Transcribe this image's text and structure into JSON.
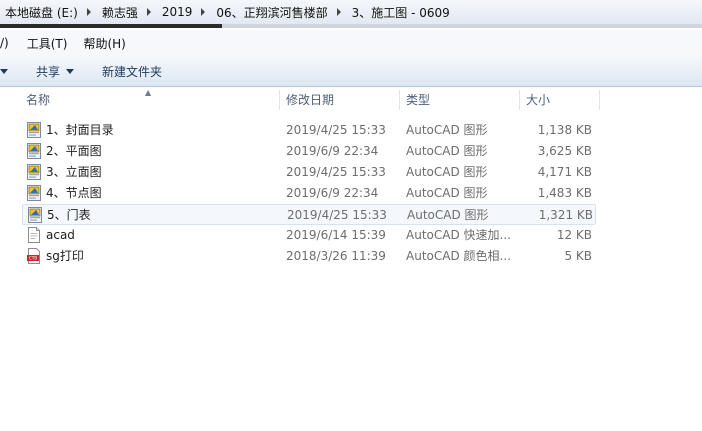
{
  "breadcrumb": [
    "本地磁盘 (E:)",
    "赖志强",
    "2019",
    "06、正翔滨河售楼部",
    "3、施工图 - 0609"
  ],
  "menu": {
    "partial_item": "/)",
    "tools": "工具(T)",
    "help": "帮助(H)"
  },
  "toolbar": {
    "share": "共享",
    "new_folder": "新建文件夹"
  },
  "columns": {
    "name": "名称",
    "modified": "修改日期",
    "type": "类型",
    "size": "大小"
  },
  "files": [
    {
      "name": "1、封面目录",
      "modified": "2019/4/25 15:33",
      "type": "AutoCAD 图形",
      "size": "1,138 KB",
      "icon": "dwg-file-icon"
    },
    {
      "name": "2、平面图",
      "modified": "2019/6/9 22:34",
      "type": "AutoCAD 图形",
      "size": "3,625 KB",
      "icon": "dwg-file-icon"
    },
    {
      "name": "3、立面图",
      "modified": "2019/4/25 15:33",
      "type": "AutoCAD 图形",
      "size": "4,171 KB",
      "icon": "dwg-file-icon"
    },
    {
      "name": "4、节点图",
      "modified": "2019/6/9 22:34",
      "type": "AutoCAD 图形",
      "size": "1,483 KB",
      "icon": "dwg-file-icon"
    },
    {
      "name": "5、门表",
      "modified": "2019/4/25 15:33",
      "type": "AutoCAD 图形",
      "size": "1,321 KB",
      "icon": "dwg-file-icon",
      "selected": true
    },
    {
      "name": "acad",
      "modified": "2019/6/14 15:39",
      "type": "AutoCAD 快速加...",
      "size": "12 KB",
      "icon": "text-file-icon"
    },
    {
      "name": "sg打印",
      "modified": "2018/3/26 11:39",
      "type": "AutoCAD 颜色相...",
      "size": "5 KB",
      "icon": "ctb-file-icon"
    }
  ],
  "colors": {
    "accent": "#1e3a5a",
    "selection": "#f4f8fd",
    "header_text": "#4c607a"
  }
}
